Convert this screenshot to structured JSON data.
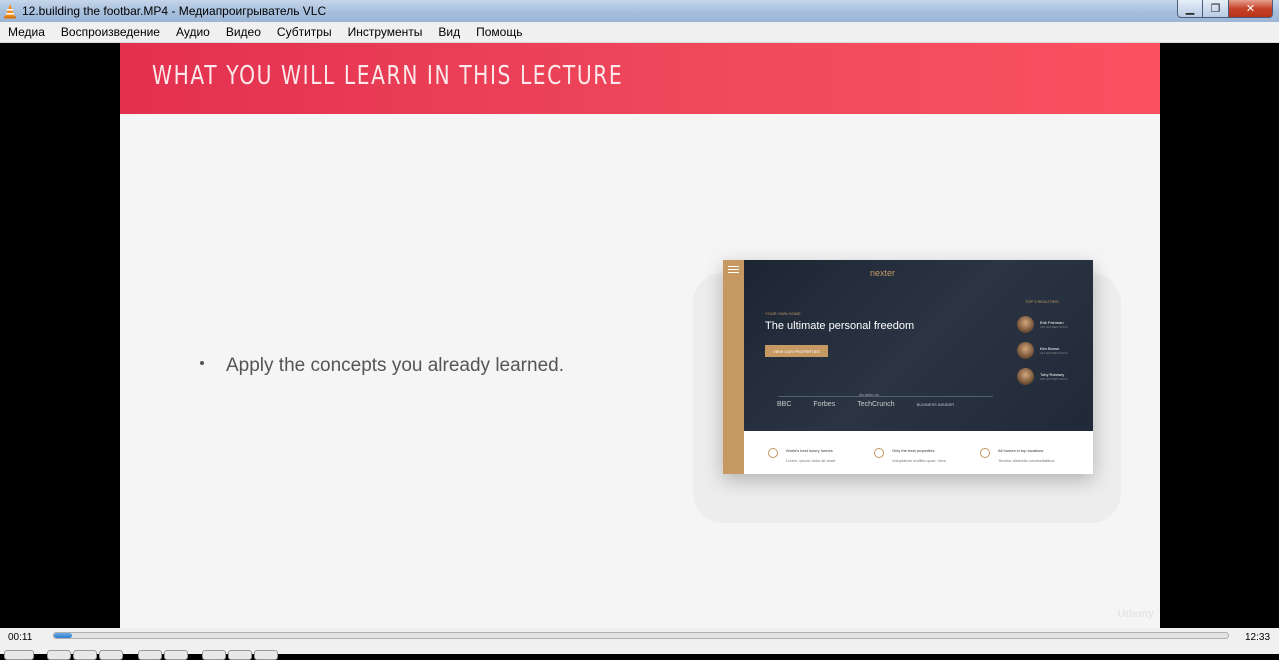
{
  "window": {
    "title": "12.building the footbar.MP4 - Медиапроигрыватель VLC",
    "app_icon": "vlc-cone-icon",
    "minimize_glyph": "▁",
    "maximize_glyph": "❐",
    "close_glyph": "✕"
  },
  "menu": [
    "Медиа",
    "Воспроизведение",
    "Аудио",
    "Видео",
    "Субтитры",
    "Инструменты",
    "Вид",
    "Помощь"
  ],
  "slide": {
    "header_title": "WHAT YOU WILL LEARN IN THIS LECTURE",
    "bullets": [
      "Apply the concepts you already learned."
    ],
    "watermark": "Udemy",
    "colors": {
      "header_start": "#e3304f",
      "header_end": "#fb5060",
      "accent": "#c69963"
    }
  },
  "mockup": {
    "logo": "nexter",
    "kicker": "YOUR OWN HOME:",
    "heading": "The ultimate personal freedom",
    "cta": "VIEW OUR PROPERTIES",
    "seen_on": "As seen on",
    "press": [
      "BBC",
      "Forbes",
      "TechCrunch",
      "BUSINESS INSIDER"
    ],
    "realtors_title": "TOP 3 REALTORS",
    "realtors": [
      {
        "name": "Erik Feinman",
        "sub": "245 HOUSES SOLD"
      },
      {
        "name": "Kim Brown",
        "sub": "212 HOUSES SOLD"
      },
      {
        "name": "Toby Ramsey",
        "sub": "198 HOUSES SOLD"
      }
    ],
    "features": [
      {
        "title": "World's best luxury homes",
        "desc": "Lorem, ipsum dolor sit amet",
        "icon": "globe-icon"
      },
      {
        "title": "Only the best properties",
        "desc": "Voluptatum mollitia quae. Vero",
        "icon": "trophy-icon"
      },
      {
        "title": "All homes in top locations",
        "desc": "Tenetur distinctio necessitatibus",
        "icon": "map-pin-icon"
      }
    ]
  },
  "player": {
    "elapsed": "00:11",
    "duration": "12:33",
    "progress_fraction": 0.015
  }
}
